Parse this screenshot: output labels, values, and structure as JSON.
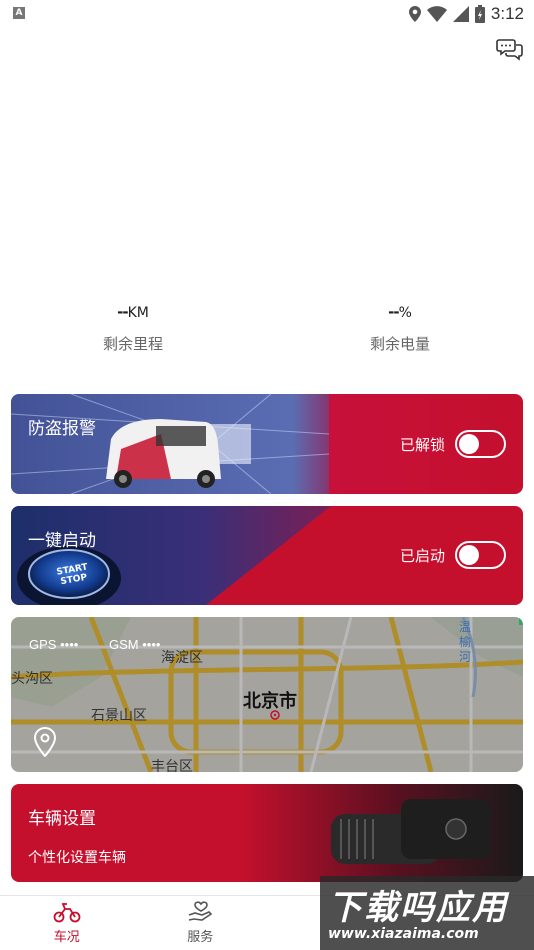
{
  "status_bar": {
    "time": "3:12",
    "icons": [
      "keyboard-icon",
      "location-icon",
      "wifi-icon",
      "cell-signal-icon",
      "battery-icon"
    ]
  },
  "header": {
    "chat_icon": "chat-bubbles-icon"
  },
  "stats": {
    "mileage": {
      "value": "--",
      "unit": "KM",
      "label": "剩余里程"
    },
    "battery": {
      "value": "--",
      "unit": "%",
      "label": "剩余电量"
    }
  },
  "cards": {
    "anti_theft": {
      "title": "防盗报警",
      "status": "已解锁",
      "toggle_on": false
    },
    "one_key_start": {
      "title": "一键启动",
      "status": "已启动",
      "toggle_on": false,
      "button_text": "START STOP"
    },
    "map": {
      "gps_label": "GPS",
      "gps_dots": "••••",
      "gsm_label": "GSM",
      "gsm_dots": "••••",
      "places": {
        "haidian": "海淀区",
        "mentougou": "头沟区",
        "shijingshan": "石景山区",
        "beijing": "北京市",
        "fengtai": "丰台区",
        "wenyu": "温榆河"
      }
    },
    "vehicle_settings": {
      "title": "车辆设置",
      "subtitle": "个性化设置车辆"
    }
  },
  "tabbar": {
    "tabs": [
      {
        "label": "车况",
        "icon": "scooter-icon",
        "active": true
      },
      {
        "label": "服务",
        "icon": "hand-heart-icon",
        "active": false
      },
      {
        "label": "",
        "icon": "",
        "active": false
      },
      {
        "label": "",
        "icon": "",
        "active": false
      }
    ]
  },
  "watermark": {
    "title": "下载吗应用",
    "url": "www.xiazaima.com"
  },
  "colors": {
    "accent": "#c4102d",
    "navy": "#1d2f6b"
  }
}
